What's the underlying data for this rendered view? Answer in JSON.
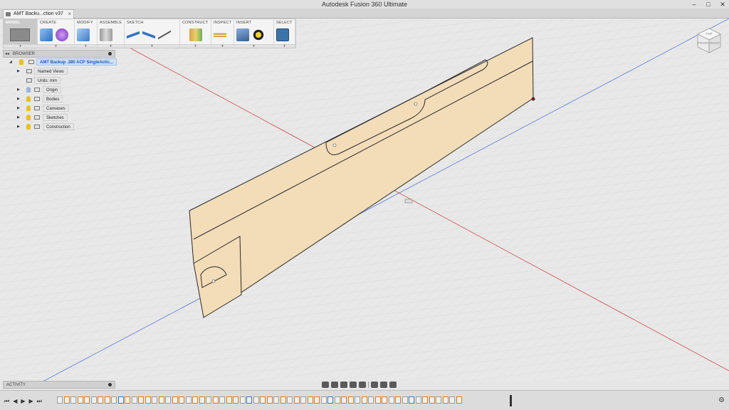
{
  "window": {
    "title": "Autodesk Fusion 360 Ultimate",
    "controls": [
      "–",
      "□",
      "✕"
    ]
  },
  "document_tab": {
    "label": "AMT Backu...ction v37",
    "close": "×"
  },
  "toolbar": {
    "groups": [
      {
        "key": "model",
        "label": "MODEL"
      },
      {
        "key": "create",
        "label": "CREATE"
      },
      {
        "key": "modify",
        "label": "MODIFY"
      },
      {
        "key": "assemble",
        "label": "ASSEMBLE"
      },
      {
        "key": "sketch",
        "label": "SKETCH"
      },
      {
        "key": "construct",
        "label": "CONSTRUCT"
      },
      {
        "key": "inspect",
        "label": "INSPECT"
      },
      {
        "key": "insert",
        "label": "INSERT"
      },
      {
        "key": "select",
        "label": "SELECT"
      }
    ],
    "dropdown_glyph": "▾"
  },
  "browser": {
    "title": "BROWSER",
    "collapse_glyph": "◂◂",
    "root": "AMT Backup .380 ACP SingleActic...",
    "items": [
      {
        "label": "Named Views"
      },
      {
        "label": "Units: mm"
      },
      {
        "label": "Origin"
      },
      {
        "label": "Bodies"
      },
      {
        "label": "Canvases"
      },
      {
        "label": "Sketches"
      },
      {
        "label": "Construction"
      }
    ]
  },
  "viewcube": {
    "faces": [
      "FRONT",
      "RIGHT",
      "TOP"
    ]
  },
  "activity": {
    "title": "ACTIVITY"
  },
  "timeline": {
    "controls": [
      "⏮",
      "◀",
      "▶",
      "▶",
      "⏭"
    ],
    "gear": "⚙"
  },
  "colors": {
    "sketch_fill": "#f3dcb8",
    "sketch_outline": "#2a2a2a",
    "grid": "#d9d9d9",
    "background": "#e6e6e6",
    "axis_red": "#d04040",
    "axis_blue": "#4a6ed8"
  }
}
